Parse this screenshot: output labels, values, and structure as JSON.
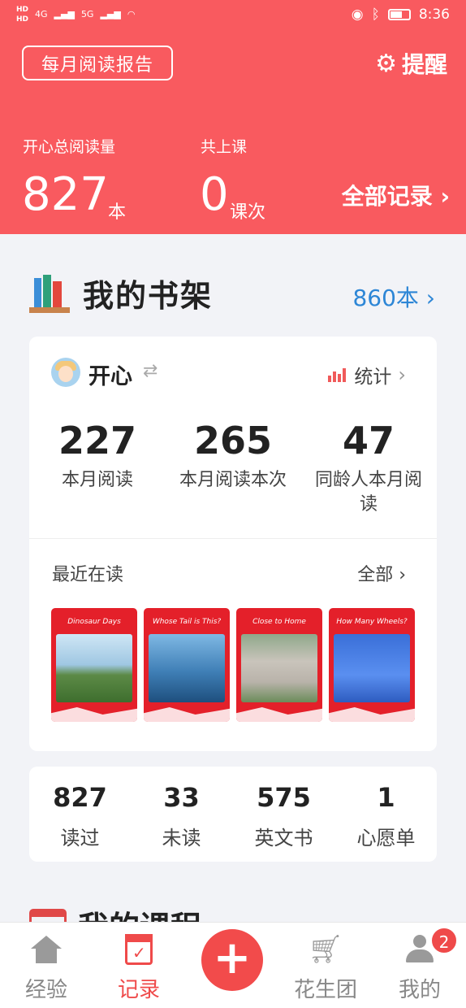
{
  "status_bar": {
    "hd1": "HD",
    "hd2": "HD",
    "net1": "4G",
    "net2": "5G",
    "time": "8:36"
  },
  "header": {
    "report_button": "每月阅读报告",
    "remind_label": "提醒",
    "total_reading_label": "开心总阅读量",
    "total_reading_value": "827",
    "total_reading_unit": "本",
    "classes_label": "共上课",
    "classes_value": "0",
    "classes_unit": "课次",
    "all_records": "全部记录 ›"
  },
  "bookshelf": {
    "title": "我的书架",
    "count": "860本 ›"
  },
  "child_card": {
    "name": "开心",
    "stats_link": "统计",
    "metrics": [
      {
        "value": "227",
        "label": "本月阅读"
      },
      {
        "value": "265",
        "label": "本月阅读本次"
      },
      {
        "value": "47",
        "label": "同龄人本月阅读"
      }
    ],
    "recent_label": "最近在读",
    "recent_all": "全部 ›",
    "books": [
      {
        "title": "Dinosaur Days"
      },
      {
        "title": "Whose Tail is This?"
      },
      {
        "title": "Close to Home"
      },
      {
        "title": "How Many Wheels?"
      }
    ]
  },
  "counts": [
    {
      "value": "827",
      "label": "读过"
    },
    {
      "value": "33",
      "label": "未读"
    },
    {
      "value": "575",
      "label": "英文书"
    },
    {
      "value": "1",
      "label": "心愿单"
    }
  ],
  "courses": {
    "title": "我的课程"
  },
  "nav": {
    "items": [
      {
        "label": "经验"
      },
      {
        "label": "记录"
      },
      {
        "label": "花生团"
      },
      {
        "label": "我的"
      }
    ],
    "badge": "2"
  },
  "colors": {
    "header_bg": "#f95a5f",
    "accent": "#ef4a4a",
    "link_blue": "#2d86d6"
  }
}
